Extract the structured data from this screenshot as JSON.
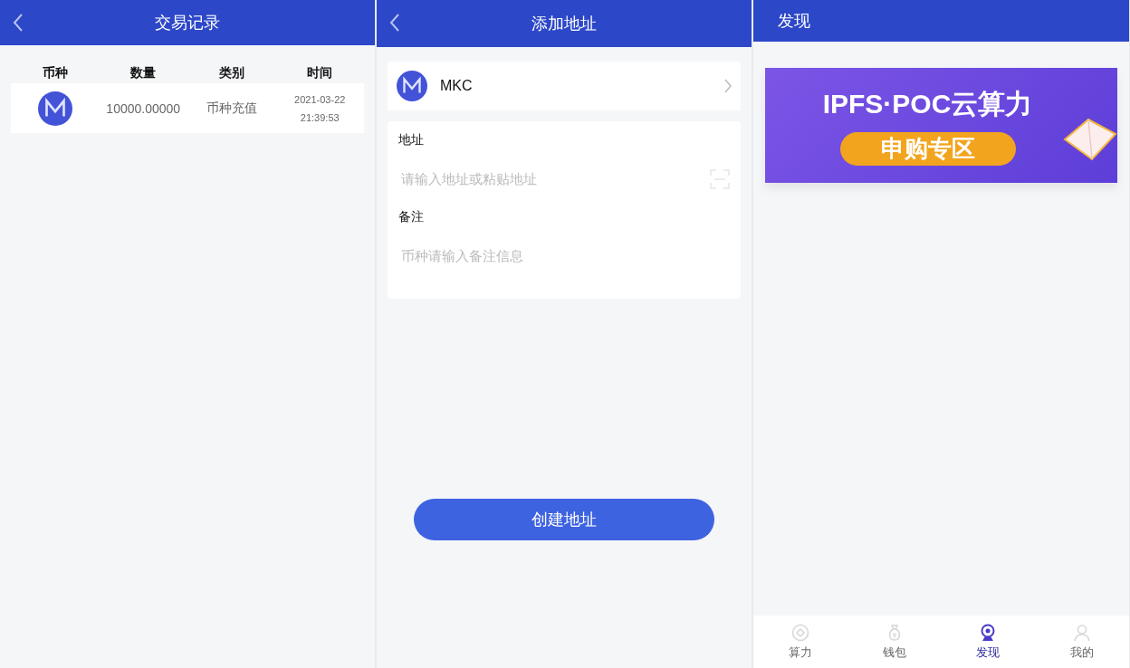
{
  "records_screen": {
    "title": "交易记录",
    "columns": [
      "币种",
      "数量",
      "类别",
      "时间"
    ],
    "rows": [
      {
        "amount": "10000.00000",
        "type": "币种充值",
        "date": "2021-03-22",
        "time": "21:39:53"
      }
    ]
  },
  "add_address_screen": {
    "title": "添加地址",
    "coin": "MKC",
    "fields": [
      {
        "label": "地址",
        "placeholder": "请输入地址或粘贴地址",
        "kind": "scan"
      },
      {
        "label": "备注",
        "placeholder": "币种请输入备注信息",
        "kind": "plain"
      }
    ],
    "button": "创建地址"
  },
  "discover_screen": {
    "title": "发现",
    "banner": {
      "headline": "IPFS·POC云算力",
      "badge": "申购专区"
    },
    "nav": [
      {
        "label": "算力",
        "selected": false
      },
      {
        "label": "钱包",
        "selected": false
      },
      {
        "label": "发现",
        "selected": true
      },
      {
        "label": "我的",
        "selected": false
      }
    ]
  }
}
